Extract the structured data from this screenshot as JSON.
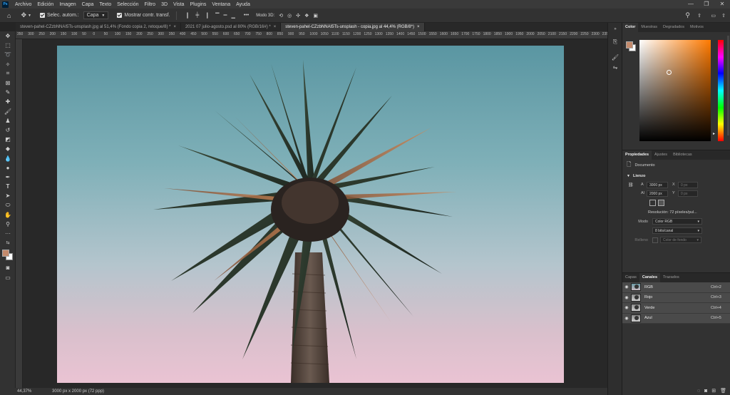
{
  "app": {
    "logo": "Ps"
  },
  "menu": [
    "Archivo",
    "Edición",
    "Imagen",
    "Capa",
    "Texto",
    "Selección",
    "Filtro",
    "3D",
    "Vista",
    "Plugins",
    "Ventana",
    "Ayuda"
  ],
  "window_controls": {
    "minimize": "—",
    "maximize": "❐",
    "close": "✕"
  },
  "options": {
    "auto_select_label": "Selec. autom.:",
    "auto_select_target": "Capa",
    "show_transform_label": "Mostrar contr. transf.",
    "more": "•••",
    "mode3d_label": "Modo 3D:"
  },
  "tabs": [
    {
      "label": "steven-pahel-CZzbNNAI5Ts-unsplash.jpg al 51,4% (Fondo copia 2, retoque/8) *",
      "close": "×"
    },
    {
      "label": "2021 07 julio-agosto.psd al 80% (RGB/16#) *",
      "close": "×"
    },
    {
      "label": "steven-pahel-CZzbNNAI5Ts-unsplash - copia.jpg al 44,4% (RGB/8*)",
      "close": "×"
    }
  ],
  "ruler_marks": [
    "350",
    "300",
    "250",
    "200",
    "150",
    "100",
    "50",
    "0",
    "50",
    "100",
    "150",
    "200",
    "250",
    "300",
    "350",
    "400",
    "450",
    "500",
    "550",
    "600",
    "650",
    "700",
    "750",
    "800",
    "850",
    "900",
    "950",
    "1000",
    "1050",
    "1100",
    "1150",
    "1200",
    "1250",
    "1300",
    "1350",
    "1400",
    "1450",
    "1500",
    "1550",
    "1600",
    "1650",
    "1700",
    "1750",
    "1800",
    "1850",
    "1900",
    "1950",
    "2000",
    "2050",
    "2100",
    "2150",
    "2200",
    "2250",
    "2300",
    "2350"
  ],
  "status": {
    "zoom": "44,37%",
    "info": "3000 px x 2000 px (72 ppp)"
  },
  "colors": {
    "foreground": "#c48a6c",
    "background": "#ffffff",
    "accent": "#31a8ff"
  },
  "color_panel": {
    "tabs": [
      "Color",
      "Muestras",
      "Degradados",
      "Motivos"
    ],
    "active": "Color"
  },
  "properties": {
    "tabs": [
      "Propiedades",
      "Ajustes",
      "Bibliotecas"
    ],
    "doc_label": "Documento",
    "canvas_header": "Lienzo",
    "width_label": "A",
    "width": "3000 px",
    "x_label": "X",
    "x_placeholder": "0 px",
    "height_label": "Al",
    "height": "2000 px",
    "y_label": "Y",
    "y_placeholder": "0 px",
    "resolution": "Resolución:  72 píxeles/pul...",
    "mode_label": "Modo",
    "mode_value": "Color RGB",
    "depth_value": "8 bits/canal",
    "fill_label": "Relleno",
    "fill_value": "Color de fondo"
  },
  "channels": {
    "tabs": [
      "Capas",
      "Canales",
      "Trazados"
    ],
    "active": "Canales",
    "rows": [
      {
        "name": "RGB",
        "key": "Ctrl+2"
      },
      {
        "name": "Rojo",
        "key": "Ctrl+3"
      },
      {
        "name": "Verde",
        "key": "Ctrl+4"
      },
      {
        "name": "Azul",
        "key": "Ctrl+5"
      }
    ]
  }
}
